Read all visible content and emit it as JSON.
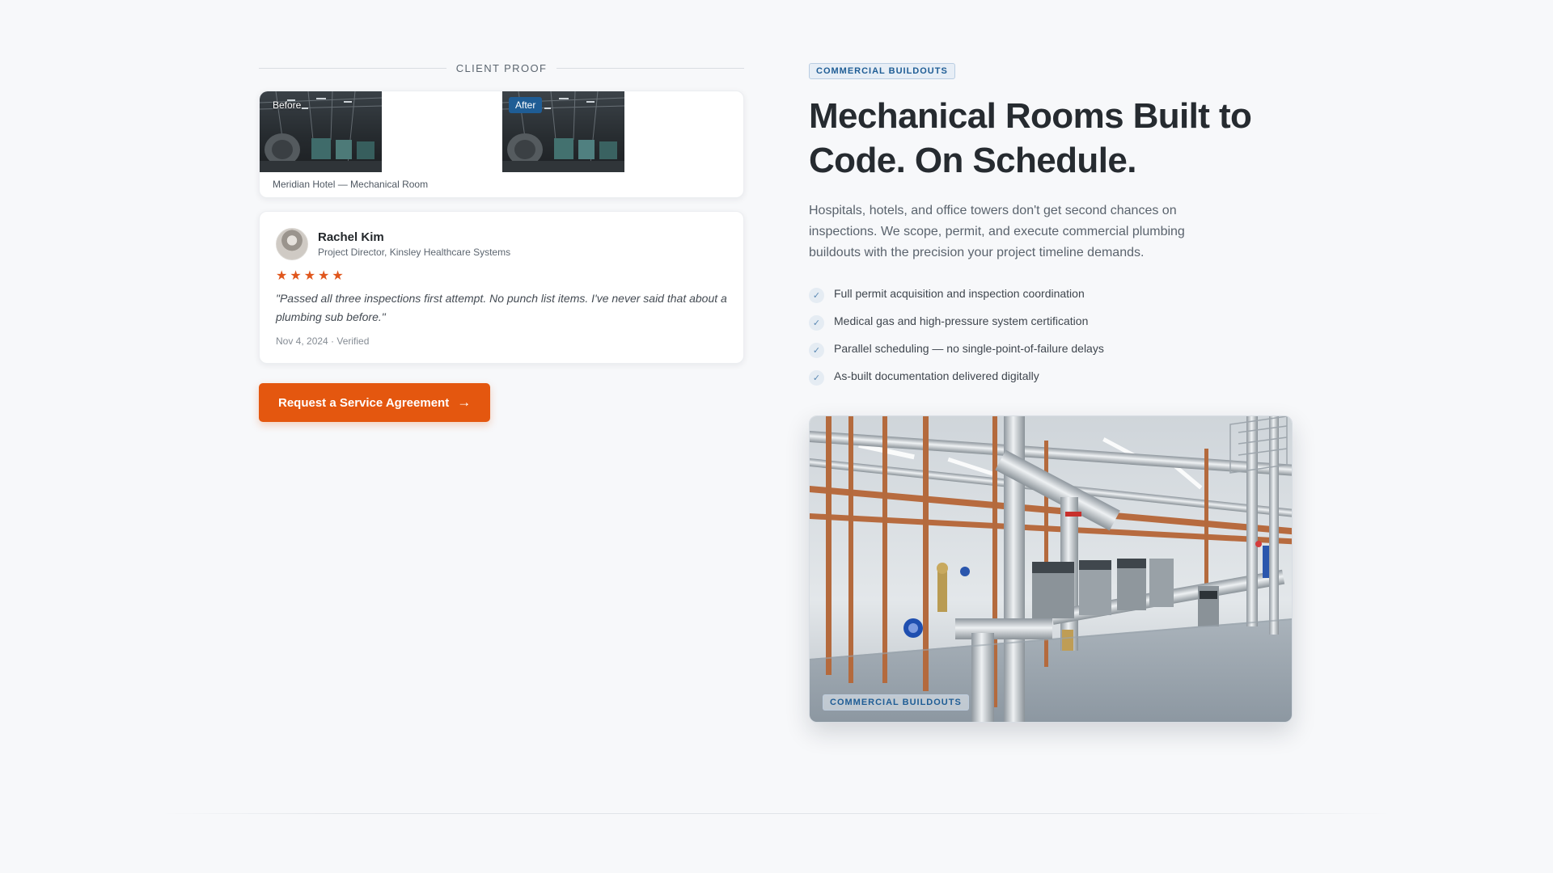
{
  "client_proof": {
    "section_label": "CLIENT PROOF",
    "before_after": {
      "before_label": "Before",
      "after_label": "After",
      "caption": "Meridian Hotel — Mechanical Room"
    },
    "review": {
      "name": "Rachel Kim",
      "role": "Project Director, Kinsley Healthcare Systems",
      "rating": 5,
      "quote": "\"Passed all three inspections first attempt. No punch list items. I've never said that about a plumbing sub before.\"",
      "meta": "Nov 4, 2024 · Verified"
    },
    "cta": {
      "label": "Request a Service Agreement",
      "icon": "arrow-right-icon"
    }
  },
  "service": {
    "badge": "COMMERCIAL BUILDOUTS",
    "headline": "Mechanical Rooms Built to Code. On Schedule.",
    "lede": "Hospitals, hotels, and office towers don't get second chances on inspections. We scope, permit, and execute commercial plumbing buildouts with the precision your project timeline demands.",
    "features": [
      "Full permit acquisition and inspection coordination",
      "Medical gas and high-pressure system certification",
      "Parallel scheduling — no single-point-of-failure delays",
      "As-built documentation delivered digitally"
    ],
    "hero_tag": "COMMERCIAL BUILDOUTS"
  },
  "colors": {
    "accent": "#e4570f",
    "brand_blue": "#1f5d95",
    "star": "#e0561c",
    "background": "#f7f8fa"
  },
  "icons": {
    "check": "check-icon",
    "star": "star-icon",
    "arrow": "arrow-right-icon"
  }
}
